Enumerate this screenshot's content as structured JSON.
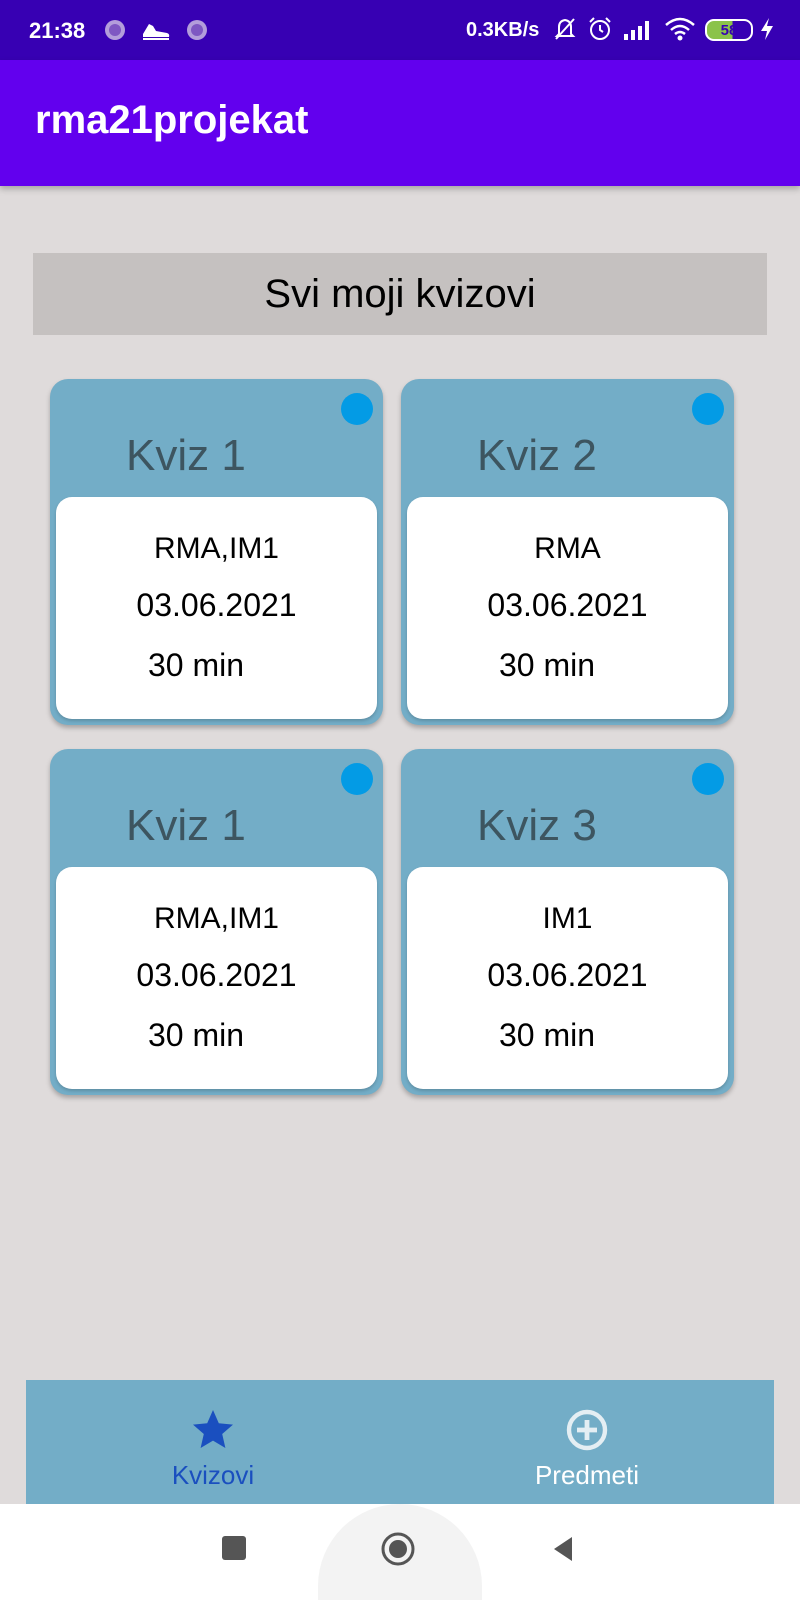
{
  "status_bar": {
    "time": "21:38",
    "network_speed": "0.3KB/s",
    "battery": "58",
    "icons": [
      "notification-app-icon",
      "sneaker-icon",
      "notification-app-icon",
      "mute-bell-icon",
      "alarm-icon",
      "signal-icon",
      "wifi-icon",
      "battery-icon",
      "charging-icon"
    ]
  },
  "app_bar": {
    "title": "rma21projekat"
  },
  "section_header": "Svi moji kvizovi",
  "quizzes": [
    {
      "name": "Kviz 1",
      "subjects": "RMA,IM1",
      "date": "03.06.2021",
      "duration": "30 min",
      "status_color": "#039be5"
    },
    {
      "name": "Kviz 2",
      "subjects": "RMA",
      "date": "03.06.2021",
      "duration": "30 min",
      "status_color": "#039be5"
    },
    {
      "name": "Kviz 1",
      "subjects": "RMA,IM1",
      "date": "03.06.2021",
      "duration": "30 min",
      "status_color": "#039be5"
    },
    {
      "name": "Kviz 3",
      "subjects": "IM1",
      "date": "03.06.2021",
      "duration": "30 min",
      "status_color": "#039be5"
    }
  ],
  "bottom_nav": {
    "items": [
      {
        "label": "Kvizovi",
        "icon": "star-icon",
        "active": true
      },
      {
        "label": "Predmeti",
        "icon": "add-circle-icon",
        "active": false
      }
    ]
  },
  "system_nav": {
    "buttons": [
      "recents-button",
      "home-button",
      "back-button"
    ]
  },
  "colors": {
    "status_bar": "#3700b3",
    "app_bar": "#6200ee",
    "background": "#dfdbdb",
    "card": "#73adc7",
    "nav_active": "#1a4fbf",
    "nav_inactive": "#ffffff"
  }
}
